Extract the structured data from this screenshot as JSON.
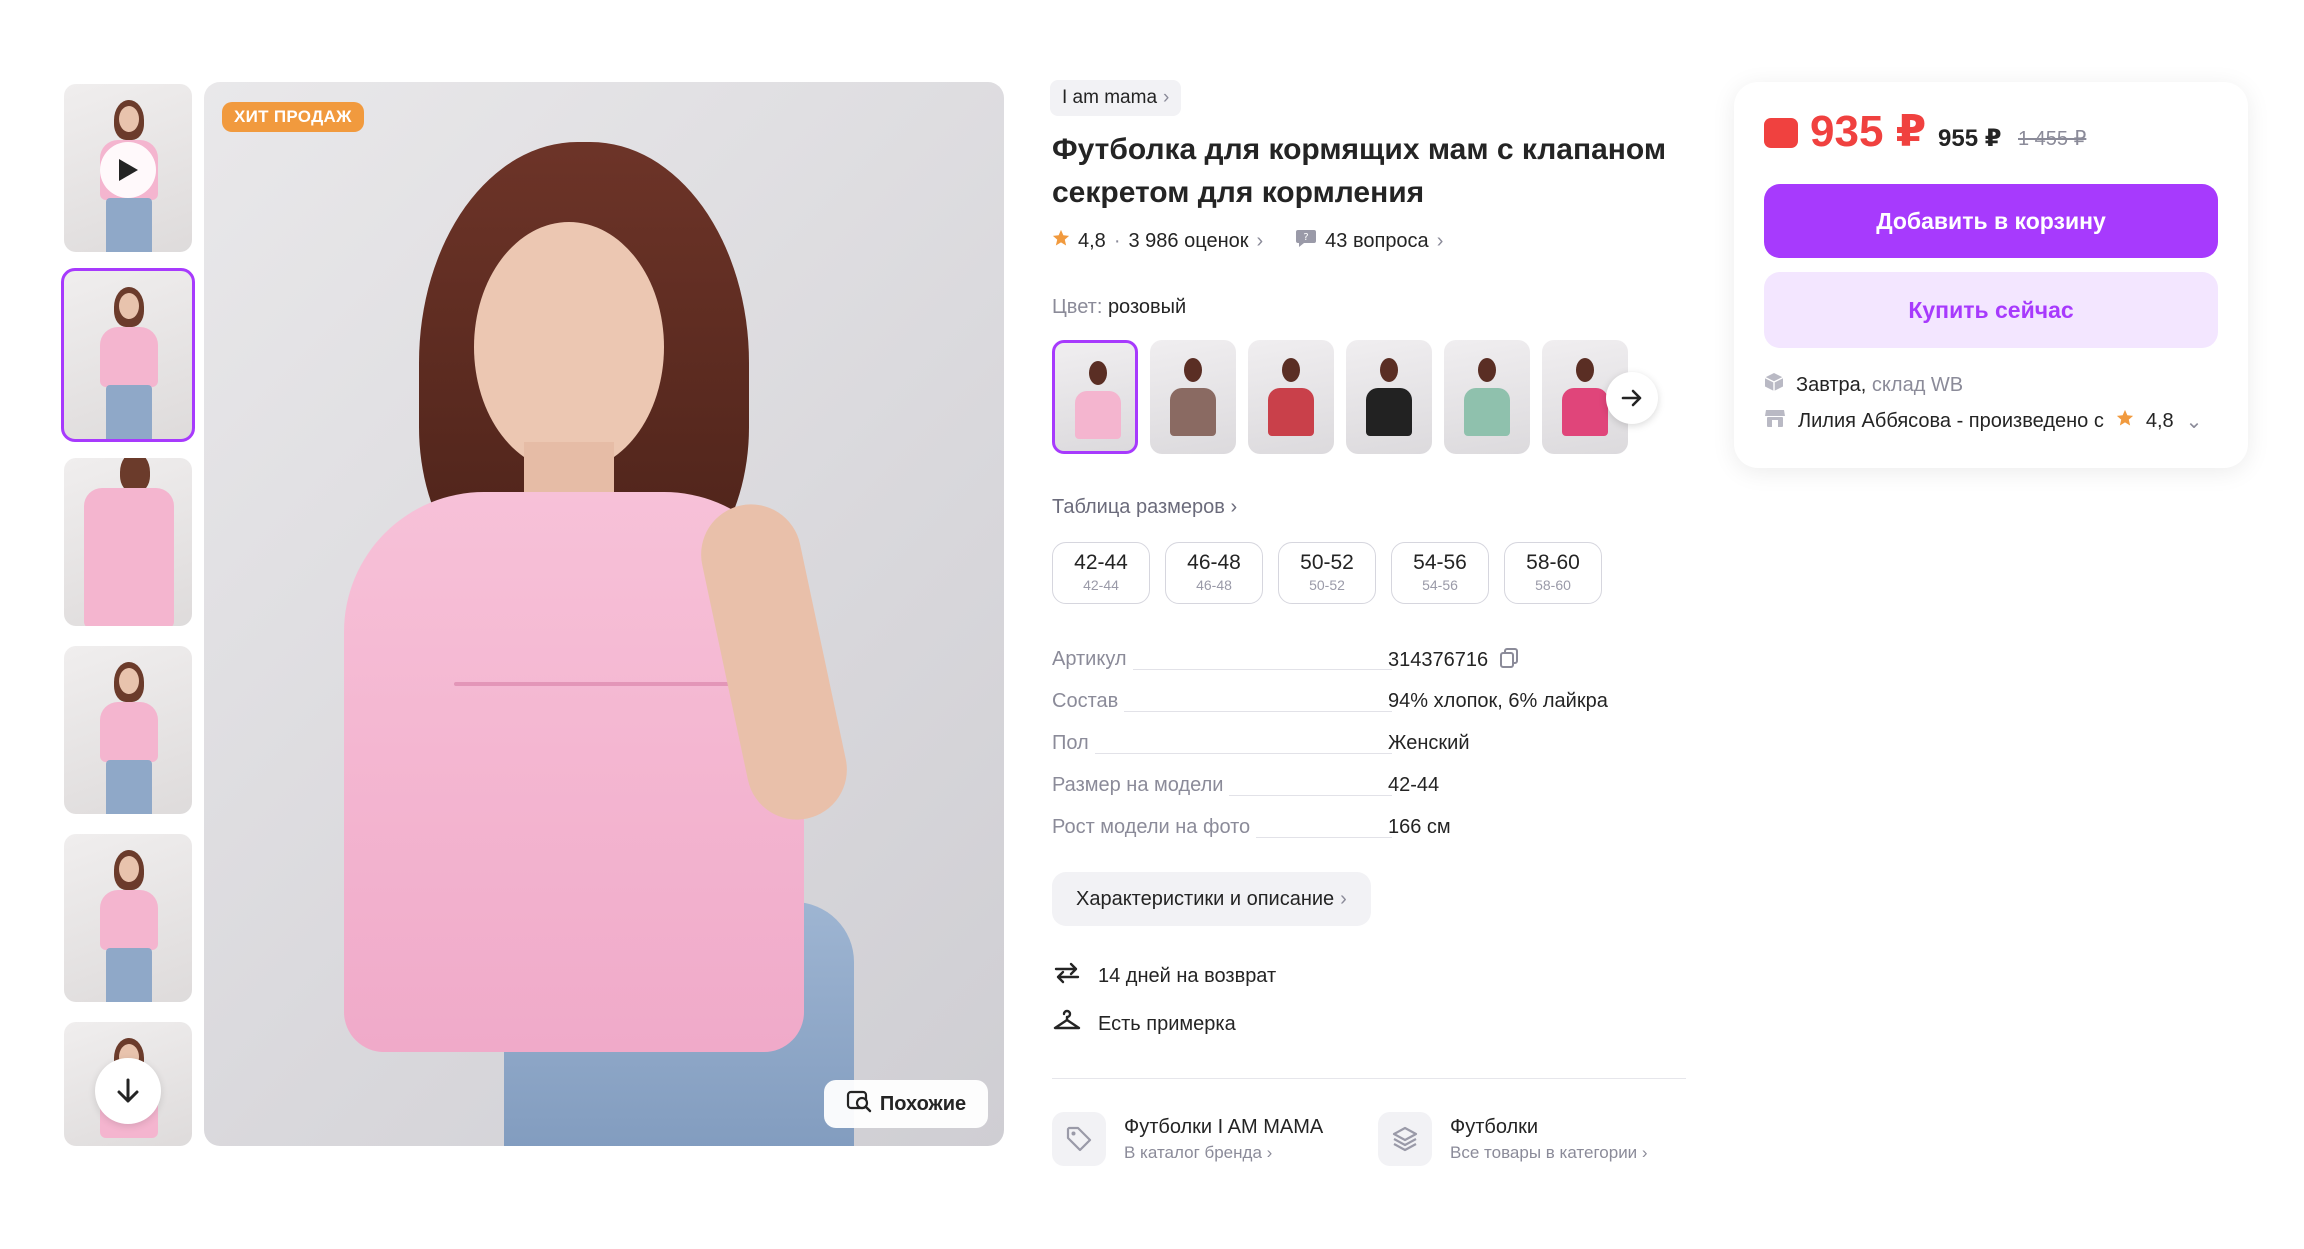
{
  "gallery": {
    "badge": "ХИТ ПРОДАЖ",
    "similar_label": "Похожие"
  },
  "product": {
    "brand": "I am mama",
    "title": "Футболка для кормящих мам с клапаном секретом для кормления",
    "rating": "4,8",
    "reviews": "3 986 оценок",
    "questions": "43 вопроса",
    "color_label": "Цвет:",
    "color_value": "розовый",
    "size_table_label": "Таблица размеров",
    "sizes": [
      {
        "main": "42-44",
        "sub": "42-44"
      },
      {
        "main": "46-48",
        "sub": "46-48"
      },
      {
        "main": "50-52",
        "sub": "50-52"
      },
      {
        "main": "54-56",
        "sub": "54-56"
      },
      {
        "main": "58-60",
        "sub": "58-60"
      }
    ],
    "specs": [
      {
        "key": "Артикул",
        "value": "314376716"
      },
      {
        "key": "Состав",
        "value": "94% хлопок, 6% лайкра"
      },
      {
        "key": "Пол",
        "value": "Женский"
      },
      {
        "key": "Размер на модели",
        "value": "42-44"
      },
      {
        "key": "Рост модели на фото",
        "value": "166 см"
      }
    ],
    "characteristics_btn": "Характеристики и описание",
    "features": [
      {
        "icon": "return-arrows-icon",
        "text": "14 дней на возврат"
      },
      {
        "icon": "hanger-icon",
        "text": "Есть примерка"
      }
    ],
    "categories": [
      {
        "title": "Футболки I AM MAMA",
        "sub": "В каталог бренда",
        "icon": "tag-icon"
      },
      {
        "title": "Футболки",
        "sub": "Все товары в категории",
        "icon": "layers-icon"
      }
    ]
  },
  "buy_box": {
    "price": "935 ₽",
    "price_alt": "955 ₽",
    "price_old": "1 455 ₽",
    "add_to_cart": "Добавить в корзину",
    "buy_now": "Купить сейчас",
    "delivery_day": "Завтра,",
    "delivery_from": "склад WB",
    "seller": "Лилия Аббясова - произведено с",
    "seller_rating": "4,8"
  },
  "colors": {
    "accent": "#a73afd",
    "price_red": "#f0413f",
    "badge_orange": "#f19a3e",
    "swatch_colors": [
      "#f4b5cf",
      "#8a6a62",
      "#c9404a",
      "#222222",
      "#8fc1ad",
      "#e0457a"
    ]
  }
}
